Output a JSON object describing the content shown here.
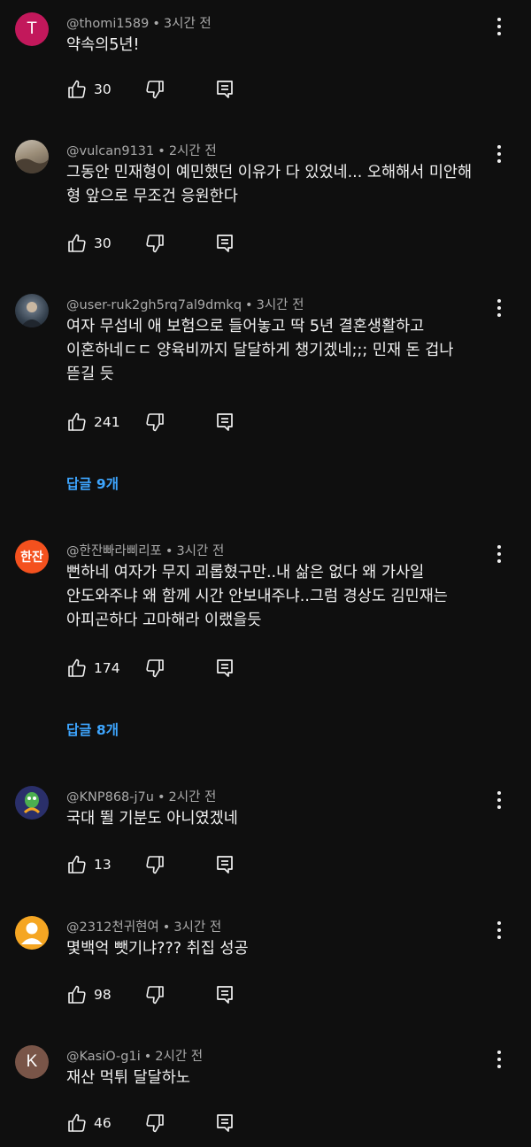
{
  "comments": [
    {
      "avatar": {
        "type": "letter",
        "text": "T",
        "color": "#c2185b"
      },
      "handle": "@thomi1589",
      "time": "3시간 전",
      "text": "약속의5년!",
      "likes": "30",
      "replies": ""
    },
    {
      "avatar": {
        "type": "image",
        "text": "",
        "color": "#8a7f72"
      },
      "handle": "@vulcan9131",
      "time": "2시간 전",
      "text": "그동안 민재형이 예민했던 이유가 다 있었네... 오해해서 미안해\n형 앞으로 무조건 응원한다",
      "likes": "30",
      "replies": ""
    },
    {
      "avatar": {
        "type": "image",
        "text": "",
        "color": "#3a4552"
      },
      "handle": "@user-ruk2gh5rq7al9dmkq",
      "time": "3시간 전",
      "text": "여자 무섭네 애 보험으로 들어놓고 딱 5년 결혼생활하고\n이혼하네ㄷㄷ  양육비까지 달달하게 챙기겠네;;; 민재 돈 겁나\n뜯길 듯",
      "likes": "241",
      "replies": "답글 9개"
    },
    {
      "avatar": {
        "type": "text",
        "text": "한잔",
        "color": "#f4511e"
      },
      "handle": "@한잔빠라삐리포",
      "time": "3시간 전",
      "text": "뻔하네 여자가 무지 괴롭혔구만..내 삶은 없다 왜 가사일\n안도와주냐 왜 함께 시간 안보내주냐..그럼 경상도 김민재는\n아피곤하다 고마해라 이랬을듯",
      "likes": "174",
      "replies": "답글 8개"
    },
    {
      "avatar": {
        "type": "image",
        "text": "",
        "color": "#2a2f6a"
      },
      "handle": "@KNP868-j7u",
      "time": "2시간 전",
      "text": "국대 뛸 기분도 아니였겠네",
      "likes": "13",
      "replies": ""
    },
    {
      "avatar": {
        "type": "person",
        "text": "",
        "color": "#f5a623"
      },
      "handle": "@2312천귀현여",
      "time": "3시간 전",
      "text": "몇백억 뺏기냐??? 취집 성공",
      "likes": "98",
      "replies": ""
    },
    {
      "avatar": {
        "type": "letter",
        "text": "K",
        "color": "#795548"
      },
      "handle": "@KasiO-g1i",
      "time": "2시간 전",
      "text": "재산 먹튀 달달하노",
      "likes": "46",
      "replies": ""
    }
  ]
}
